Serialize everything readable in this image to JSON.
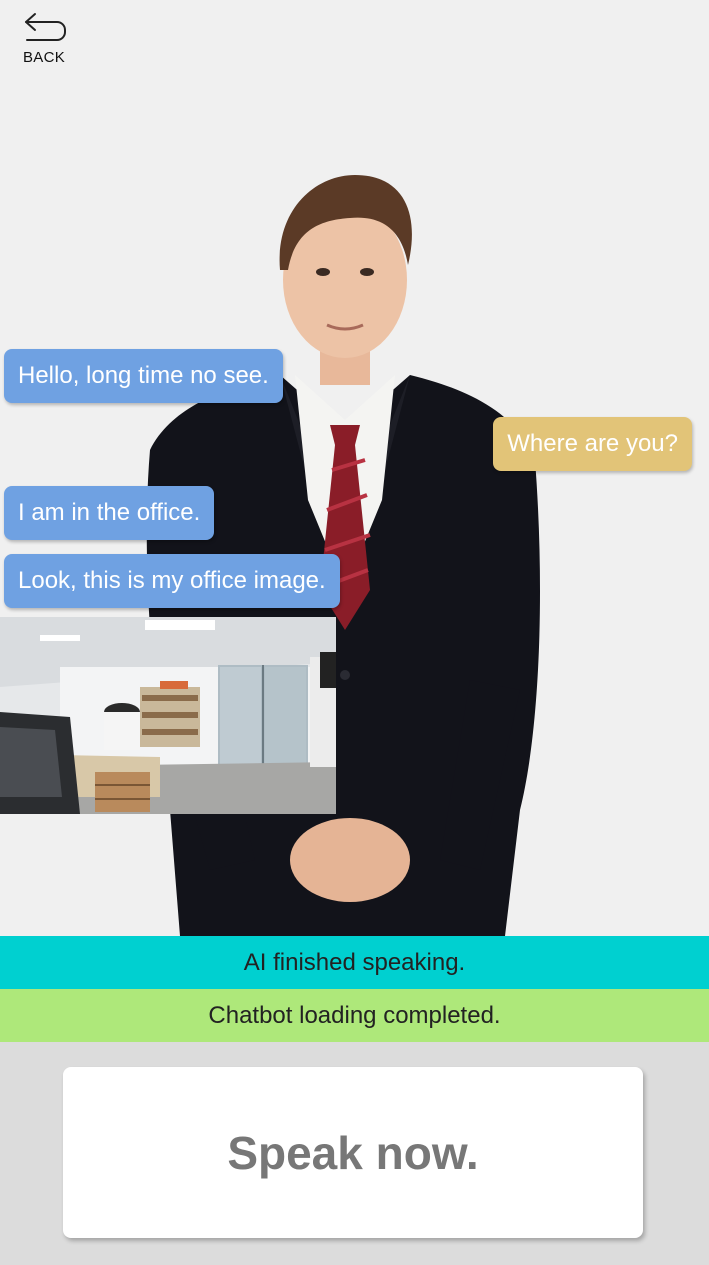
{
  "nav": {
    "back_label": "BACK",
    "back_icon": "back-arrow-icon"
  },
  "chat": {
    "messages": [
      {
        "role": "ai",
        "text": "Hello,  long time no see."
      },
      {
        "role": "user",
        "text": "Where are you?"
      },
      {
        "role": "ai",
        "text": "I am in the office."
      },
      {
        "role": "ai",
        "text": "Look, this is my office image."
      }
    ]
  },
  "status": {
    "ai_state": "AI finished speaking.",
    "loading_state": "Chatbot loading completed."
  },
  "action": {
    "speak_label": "Speak now."
  },
  "colors": {
    "ai_bubble": "#6fa1e2",
    "user_bubble": "#e2c478",
    "status_ai": "#00d0d0",
    "status_loading": "#aee87a",
    "footer_bg": "#dcdcdc"
  }
}
